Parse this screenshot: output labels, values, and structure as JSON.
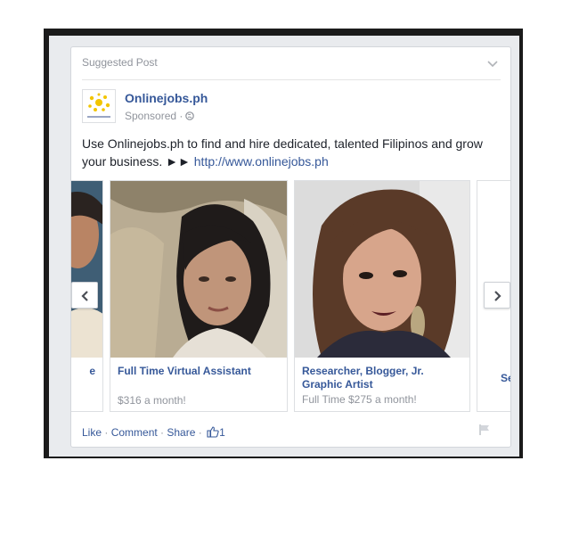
{
  "post": {
    "header_label": "Suggested Post",
    "page_name": "Onlinejobs.ph",
    "sponsored_label": "Sponsored",
    "dot": "·",
    "body_text": "Use Onlinejobs.ph to find and hire dedicated, talented Filipinos and grow your business. ►► ",
    "link_text": "http://www.onlinejobs.ph"
  },
  "carousel": {
    "items": [
      {
        "title": "e",
        "subtitle": ""
      },
      {
        "title": "Full Time Virtual Assistant",
        "subtitle": "$316 a month!"
      },
      {
        "title": "Researcher, Blogger, Jr. Graphic Artist",
        "subtitle": "Full Time $275 a month!"
      },
      {
        "title": "Se",
        "subtitle": ""
      }
    ]
  },
  "footer": {
    "like": "Like",
    "comment": "Comment",
    "share": "Share",
    "sep": " · ",
    "like_count": "1"
  },
  "colors": {
    "link": "#365899",
    "meta": "#90949c",
    "text": "#1d2129",
    "border": "#dddfe2"
  },
  "icons": [
    "chevron-down-icon",
    "globe-icon",
    "prev-arrow-icon",
    "next-arrow-icon",
    "thumbs-up-icon",
    "flag-icon"
  ]
}
